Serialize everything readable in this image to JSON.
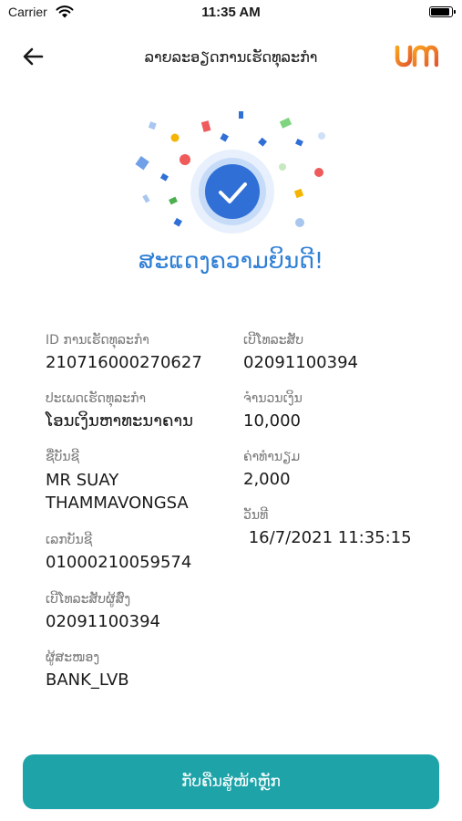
{
  "status_bar": {
    "carrier": "Carrier",
    "time": "11:35 AM"
  },
  "header": {
    "title": "ລາຍລະອຽດການເຮັດທຸລະກຳ",
    "back_icon": "arrow-left-icon",
    "logo_text": "um"
  },
  "main": {
    "heading": "ສະແດງຄວາມຍິນດີ!",
    "success_icon": "check-circle-icon",
    "left_details": [
      {
        "label": "ID ການເຮັດທຸລະກຳ",
        "value": "210716000270627"
      },
      {
        "label": "ປະເພດເຮັດທຸລະກຳ",
        "value": "ໂອນເງິນຫາທະນາຄານ"
      },
      {
        "label": "ຊື່ບັນຊີ",
        "value": "MR SUAY\nTHAMMAVONGSA"
      },
      {
        "label": "ເລກບັນຊີ",
        "value": "01000210059574"
      },
      {
        "label": "ເບີໂທລະສັບຜູ້ສົ່ງ",
        "value": "02091100394"
      },
      {
        "label": "ຜູ້ສະໜອງ",
        "value": "BANK_LVB"
      }
    ],
    "right_details": [
      {
        "label": "ເບີໂທລະສັບ",
        "value": "02091100394"
      },
      {
        "label": "ຈຳນວນເງິນ",
        "value": "10,000"
      },
      {
        "label": "ຄ່າທຳນຽມ",
        "value": "2,000"
      },
      {
        "label": "ວັນທີ",
        "value": " 16/7/2021 11:35:15"
      }
    ]
  },
  "footer": {
    "home_button_label": "ກັບຄືນສູ່ໜ້າຫຼັກ"
  },
  "colors": {
    "accent": "#2f7fd6",
    "button": "#1ea3a8",
    "logo": "#f07a1a"
  }
}
